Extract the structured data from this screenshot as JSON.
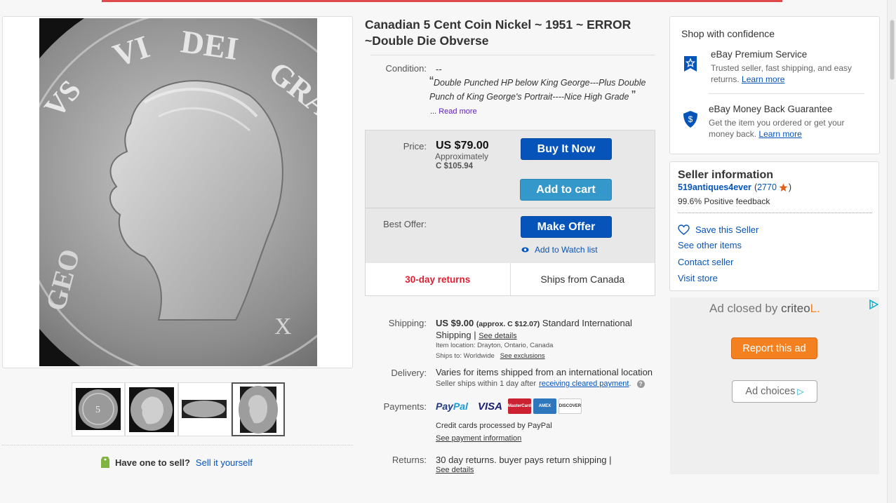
{
  "listing": {
    "title": "Canadian 5 Cent Coin Nickel ~ 1951 ~ ERROR ~Double Die Obverse",
    "condition_label": "Condition:",
    "condition_value": "--",
    "description": "Double Punched HP below King George---Plus Double Punch of King George's Portrait----Nice High Grade",
    "readmore_prefix": "...",
    "readmore_link": "Read more"
  },
  "buybox": {
    "price_label": "Price:",
    "price": "US $79.00",
    "approx_label": "Approximately",
    "converted_price": "C $105.94",
    "buy_now": "Buy It Now",
    "add_to_cart": "Add to cart",
    "best_offer_label": "Best Offer:",
    "make_offer": "Make Offer",
    "watch_list": "Add to Watch list",
    "returns_badge": "30-day returns",
    "ships_from": "Ships from Canada"
  },
  "shipping": {
    "label": "Shipping:",
    "cost": "US $9.00",
    "approx": "(approx. C $12.07)",
    "service": "Standard International Shipping |",
    "see_details": "See details",
    "item_location": "Item location:  Drayton, Ontario, Canada",
    "ships_to": "Ships to:  Worldwide",
    "see_exclusions": "See exclusions"
  },
  "delivery": {
    "label": "Delivery:",
    "value": "Varies for items shipped from an international location",
    "sub": "Seller ships within 1 day after",
    "sub_link": "receiving cleared payment",
    "sub_end": ".",
    "help": "?"
  },
  "payments": {
    "label": "Payments:",
    "paypal_a": "Pay",
    "paypal_b": "Pal",
    "visa": "VISA",
    "mastercard": "MasterCard",
    "amex": "AMEX",
    "discover": "DISCOVER",
    "note": "Credit cards processed by PayPal",
    "link": "See payment information"
  },
  "returns": {
    "label": "Returns:",
    "value": "30 day returns. buyer pays return shipping |",
    "link": "See details"
  },
  "sell": {
    "question": "Have one to sell?",
    "link": "Sell it yourself"
  },
  "confidence": {
    "title": "Shop with confidence",
    "items": [
      {
        "title": "eBay Premium Service",
        "desc": "Trusted seller, fast shipping, and easy returns.",
        "link": "Learn more"
      },
      {
        "title": "eBay Money Back Guarantee",
        "desc": "Get the item you ordered or get your money back.",
        "link": "Learn more"
      }
    ]
  },
  "seller": {
    "title": "Seller information",
    "username": "519antiques4ever",
    "open_paren": "(",
    "score": "2770",
    "close_paren": ")",
    "feedback": "99.6% Positive feedback",
    "save": "Save this Seller",
    "links": [
      "See other items",
      "Contact seller",
      "Visit store"
    ]
  },
  "ad": {
    "closed_prefix": "Ad closed by",
    "brand": "criteo",
    "brand_mark": "L.",
    "report": "Report this ad",
    "choices": "Ad choices",
    "choices_mark": "▷"
  },
  "colors": {
    "accent_blue": "#0654ba",
    "cart_blue": "#3498ca",
    "returns_red": "#dd1e31",
    "top_bar": "#e0494b",
    "ad_orange": "#f48120"
  },
  "icons": [
    "shield-star-icon",
    "shield-dollar-icon",
    "heart-icon",
    "eye-icon",
    "star-icon",
    "tag-icon",
    "ad-info-icon",
    "help-icon"
  ]
}
